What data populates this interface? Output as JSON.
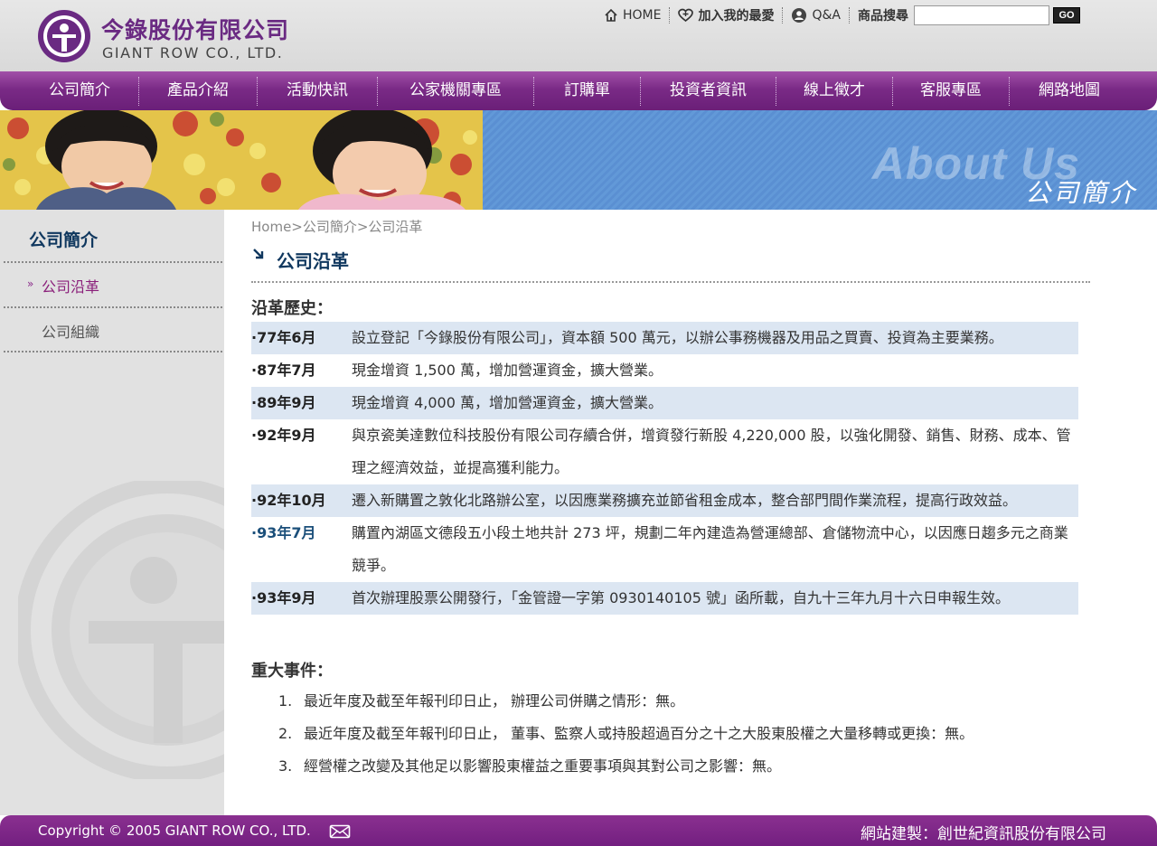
{
  "header": {
    "company_name_zh": "今錄股份有限公司",
    "company_name_en": "GIANT ROW CO., LTD.",
    "top_links": {
      "home": "HOME",
      "favorite": "加入我的最愛",
      "qa": "Q&A"
    },
    "search": {
      "label": "商品搜尋",
      "value": "",
      "button": "GO"
    }
  },
  "nav": {
    "items": [
      "公司簡介",
      "產品介紹",
      "活動快訊",
      "公家機關專區",
      "訂購單",
      "投資者資訊",
      "線上徵才",
      "客服專區",
      "網路地圖"
    ]
  },
  "banner": {
    "title_en": "About Us",
    "title_zh": "公司簡介"
  },
  "sidebar": {
    "title": "公司簡介",
    "items": [
      {
        "label": "公司沿革",
        "active": true
      },
      {
        "label": "公司組織",
        "active": false
      }
    ]
  },
  "main": {
    "breadcrumb": "Home>公司簡介>公司沿革",
    "title": "公司沿革",
    "history_heading": "沿革歷史：",
    "history": [
      {
        "date": "·77年6月",
        "text": "設立登記「今錄股份有限公司」，資本額 500 萬元，以辦公事務機器及用品之買賣、投資為主要業務。",
        "shaded": true
      },
      {
        "date": "·87年7月",
        "text": "現金增資 1,500 萬，增加營運資金，擴大營業。",
        "shaded": false
      },
      {
        "date": "·89年9月",
        "text": "現金增資 4,000 萬，增加營運資金，擴大營業。",
        "shaded": true
      },
      {
        "date": "·92年9月",
        "text": "與京瓷美達數位科技股份有限公司存續合併，增資發行新股 4,220,000 股，以強化開發、銷售、財務、成本、管理之經濟效益，並提高獲利能力。",
        "shaded": false
      },
      {
        "date": "·92年10月",
        "text": "遷入新購置之敦化北路辦公室，以因應業務擴充並節省租金成本，整合部門間作業流程，提高行政效益。",
        "shaded": true
      },
      {
        "date": "·93年7月",
        "text": "購置內湖區文德段五小段土地共計 273 坪，規劃二年內建造為營運總部、倉儲物流中心，以因應日趨多元之商業競爭。",
        "shaded": false
      },
      {
        "date": "·93年9月",
        "text": "首次辦理股票公開發行，「金管證一字第 0930140105 號」函所載，自九十三年九月十六日申報生效。",
        "shaded": true
      }
    ],
    "events_heading": "重大事件：",
    "events": [
      {
        "num": "1.",
        "text": "最近年度及截至年報刊印日止， 辦理公司併購之情形：無。"
      },
      {
        "num": "2.",
        "text": "最近年度及截至年報刊印日止， 董事、監察人或持股超過百分之十之大股東股權之大量移轉或更換：無。"
      },
      {
        "num": "3.",
        "text": "經營權之改變及其他足以影響股東權益之重要事項與其對公司之影響：無。"
      }
    ]
  },
  "footer": {
    "copyright": "Copyright © 2005 GIANT ROW CO., LTD.",
    "credit": "網站建製：創世紀資訊股份有限公司"
  },
  "colors": {
    "brand_purple": "#7a2a86",
    "title_navy": "#10385f",
    "row_shade": "#dce6f2",
    "banner_blue": "#5a8fd2"
  }
}
